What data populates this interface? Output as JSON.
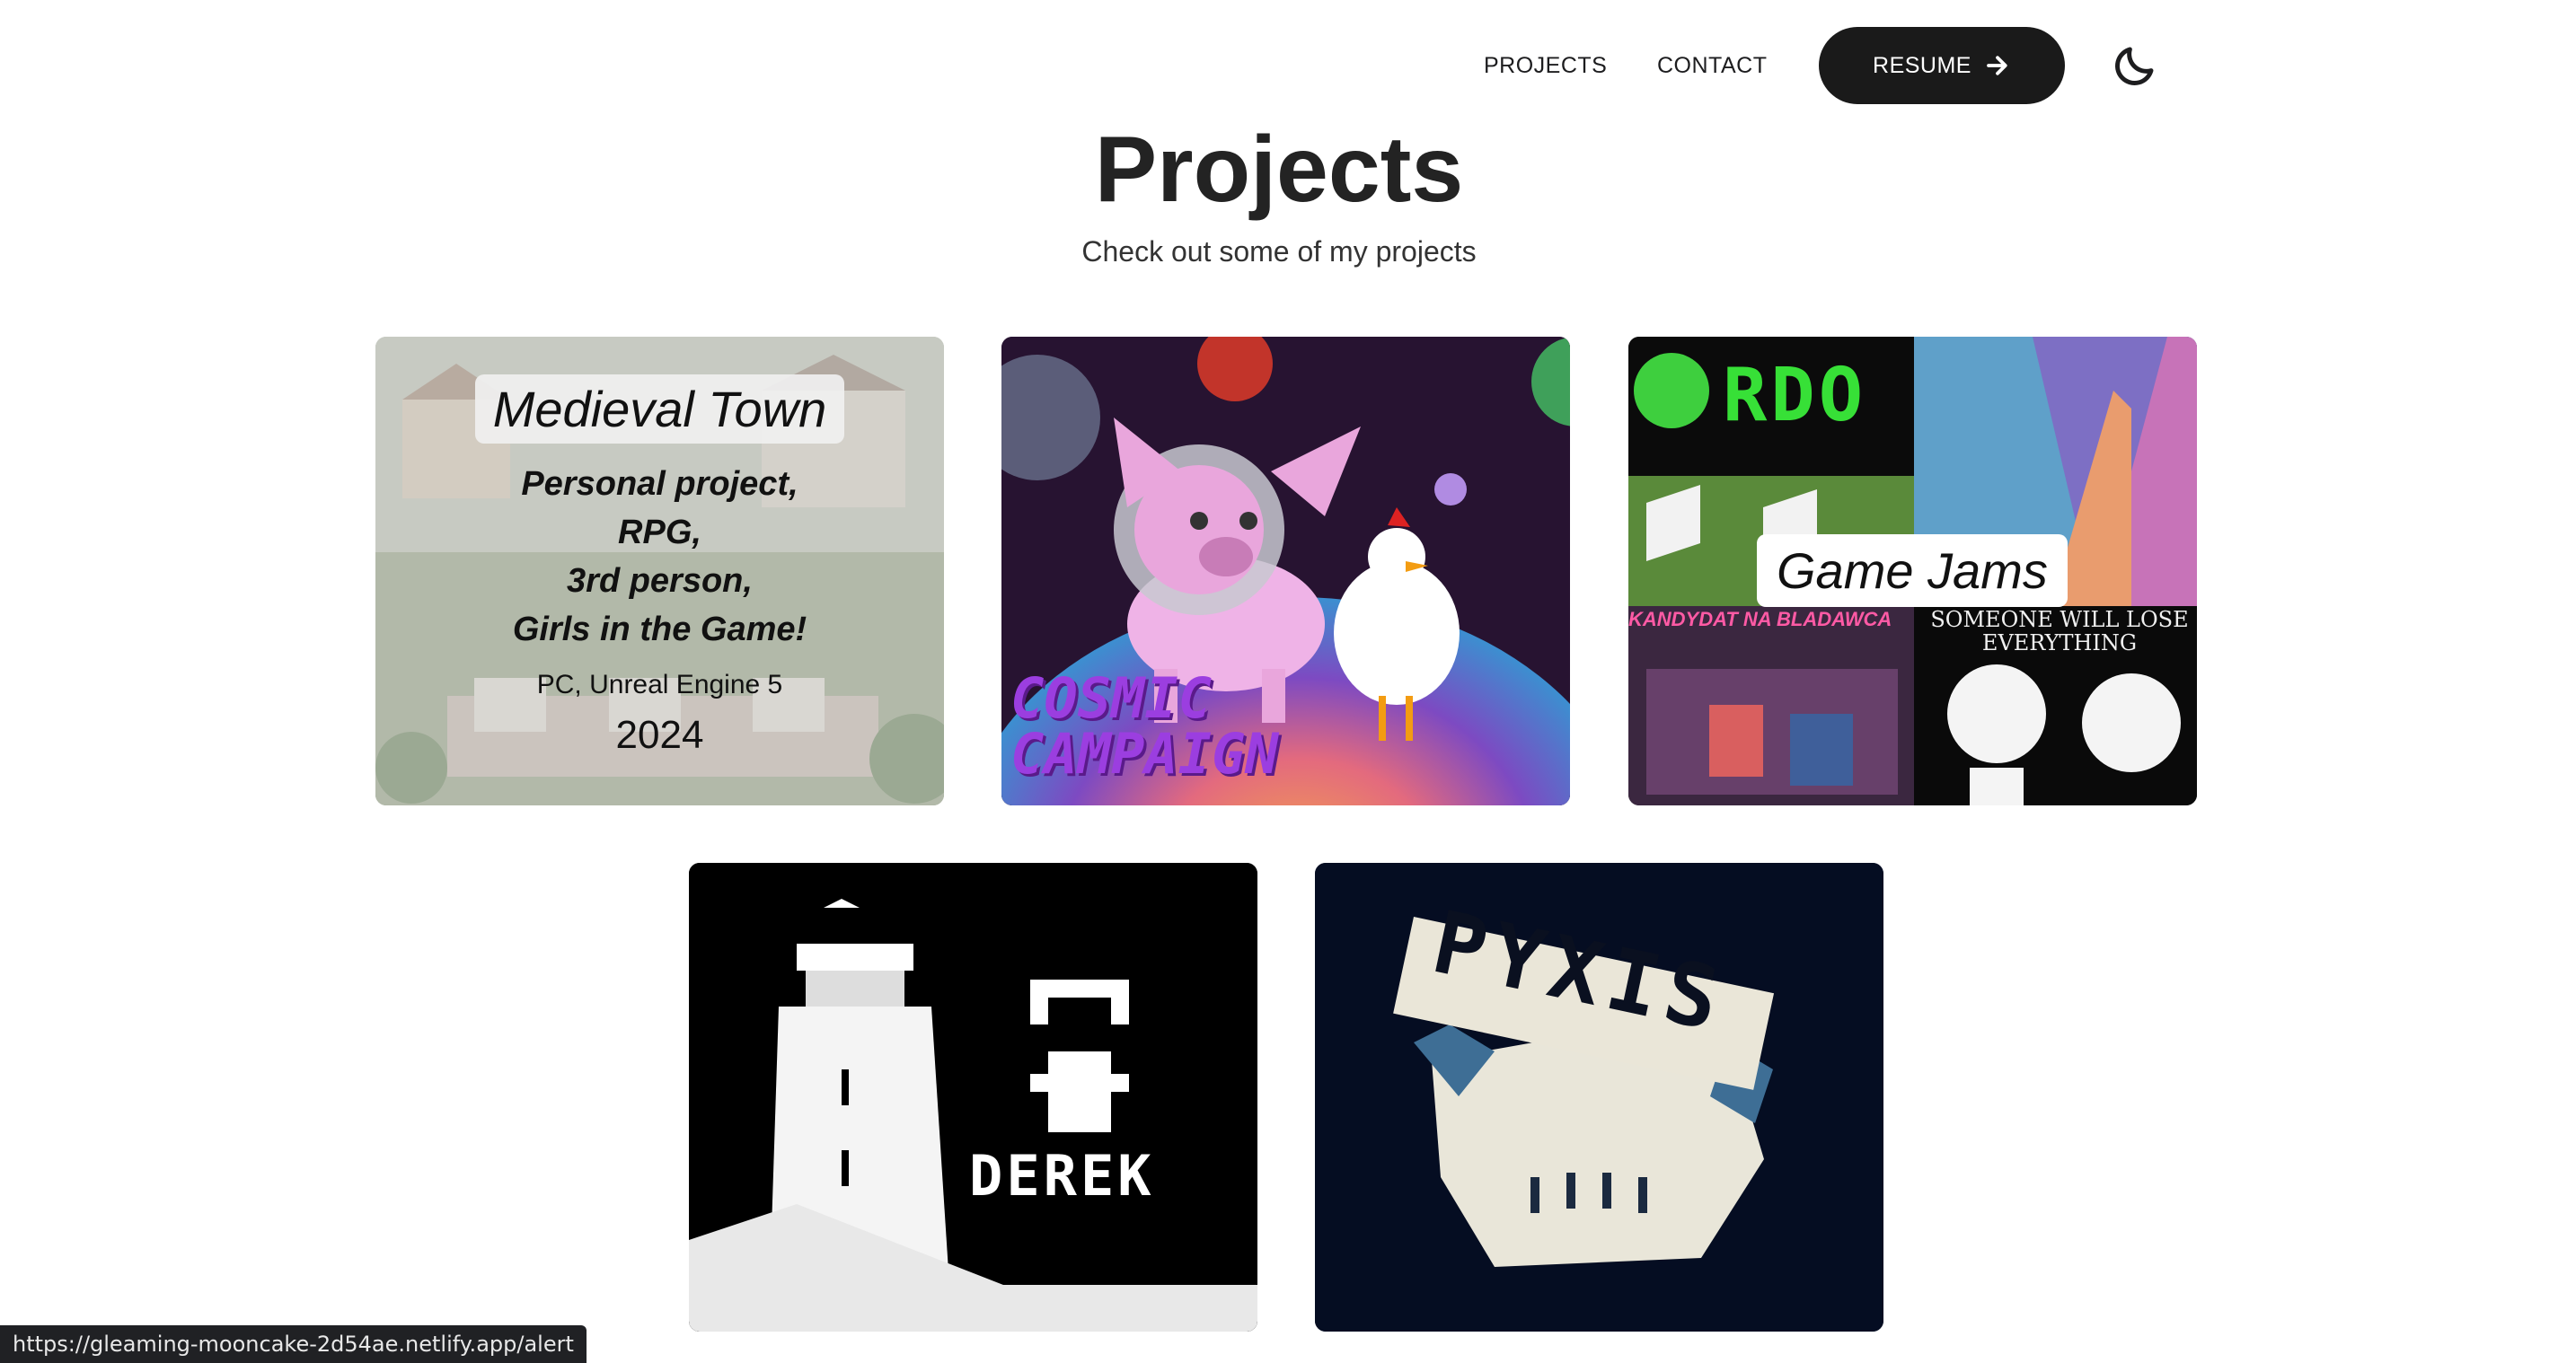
{
  "nav": {
    "links": [
      "PROJECTS",
      "CONTACT"
    ],
    "resume_label": "RESUME"
  },
  "header": {
    "title": "Projects",
    "subtitle": "Check out some of my projects"
  },
  "cards": [
    {
      "title": "Medieval Town",
      "description": "Personal project,\nRPG,\n3rd person,\nGirls in the Game!",
      "platform": "PC, Unreal Engine 5",
      "year": "2024"
    },
    {
      "logo_text": "COSMIC CAMPAIGN"
    },
    {
      "title": "Game Jams",
      "tiles": [
        "RDO",
        "KANDYDAT NA BLADAWCA",
        "SOMEONE WILL LOSE EVERYTHING"
      ]
    },
    {
      "logo_text": "DEREK"
    },
    {
      "logo_text": "PYXIS"
    }
  ],
  "statusbar": {
    "url": "https://gleaming-mooncake-2d54ae.netlify.app/alert"
  },
  "colors": {
    "accent_dark": "#1a1a1a",
    "cosmic_purple": "#8a35d6",
    "pyxis_bg": "#050d22"
  }
}
